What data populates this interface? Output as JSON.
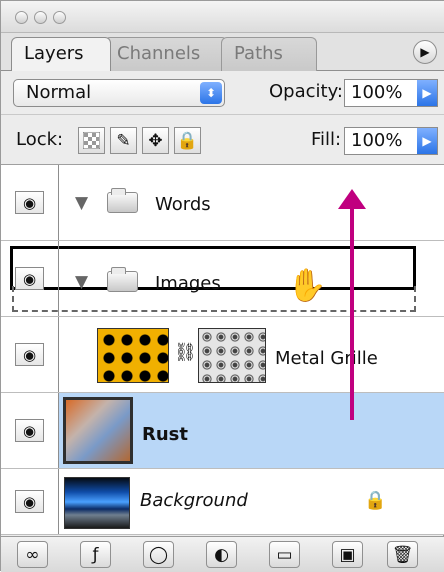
{
  "tabs": [
    {
      "label": "Layers"
    },
    {
      "label": "Channels"
    },
    {
      "label": "Paths"
    }
  ],
  "blend_mode": "Normal",
  "opacity": {
    "label": "Opacity:",
    "value": "100%"
  },
  "lock": {
    "label": "Lock:"
  },
  "fill": {
    "label": "Fill:",
    "value": "100%"
  },
  "layers": [
    {
      "name": "Words",
      "type": "group"
    },
    {
      "name": "Images",
      "type": "group"
    },
    {
      "name": "Metal Grille",
      "type": "layer-with-mask"
    },
    {
      "name": "Rust",
      "type": "layer",
      "selected": true
    },
    {
      "name": "Background",
      "type": "background",
      "locked": true
    }
  ],
  "icons": {
    "panel_menu": "panel-menu-icon",
    "lock_transparency": "checkerboard-icon",
    "lock_paint": "brush-icon",
    "lock_position": "move-icon",
    "lock_all": "lock-icon",
    "visibility": "eye-icon",
    "drag": "hand-icon",
    "mask_link": "chain-link-icon",
    "footer_link": "link-icon",
    "footer_style": "style-icon",
    "footer_mask": "mask-icon",
    "footer_adjust": "adjustment-icon",
    "footer_group": "folder-icon",
    "footer_new": "new-layer-icon",
    "footer_trash": "trash-icon"
  },
  "colors": {
    "accent_blue": "#2b74e7",
    "selection": "#b9d7f7",
    "arrow_magenta": "#c0007f"
  }
}
